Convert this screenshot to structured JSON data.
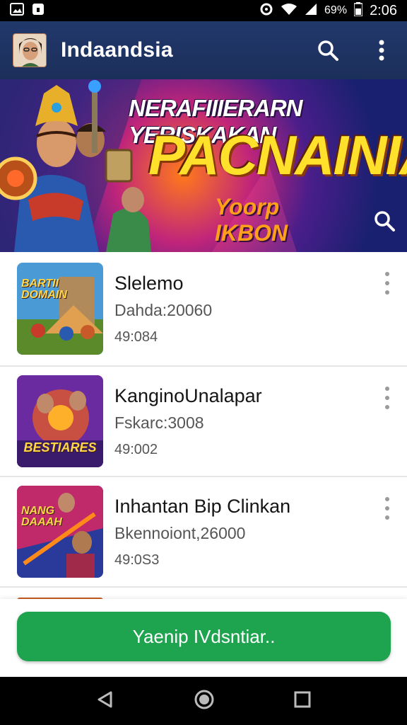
{
  "status_bar": {
    "time": "2:06",
    "battery": "69%",
    "icons": [
      "image-icon",
      "lock-icon",
      "data-saver-icon",
      "wifi-icon",
      "cellular-icon",
      "battery-icon"
    ]
  },
  "app_bar": {
    "title": "Indaandsia",
    "icons": [
      "avatar",
      "search-icon",
      "more-vert-icon"
    ]
  },
  "banner": {
    "line1": "NERAFIIIERARN YERISKAKAN",
    "line2": "PACNAINIA",
    "line3": "Yoorp IKBON",
    "icons": [
      "search-icon"
    ]
  },
  "list": {
    "items": [
      {
        "title": "Slelemo",
        "subtitle": "Dahda:20060",
        "meta": "49:084",
        "thumb_text": "BARTII DOMAIN",
        "thumb_colors": [
          "#4a9ad6",
          "#e0a050",
          "#5a8a2a"
        ]
      },
      {
        "title": "KanginoUnalapar",
        "subtitle": "Fskarc:3008",
        "meta": "49:002",
        "thumb_text": "BESTIARES",
        "thumb_colors": [
          "#6a2aa0",
          "#e05a2a",
          "#ffb02a"
        ]
      },
      {
        "title": "Inhantan Bip Clinkan",
        "subtitle": "Bkennoiont,26000",
        "meta": "49:0S3",
        "thumb_text": "NANG DAAAH",
        "thumb_colors": [
          "#c02a6a",
          "#ff8a1a",
          "#2a3a9a"
        ]
      }
    ]
  },
  "cta": {
    "label": "Yaenip IVdsntiar.."
  },
  "nav_bar": {
    "icons": [
      "back-icon",
      "home-icon",
      "recents-icon"
    ]
  },
  "colors": {
    "app_bar": "#21386b",
    "cta": "#1ea34f",
    "status_bar": "#000000"
  }
}
